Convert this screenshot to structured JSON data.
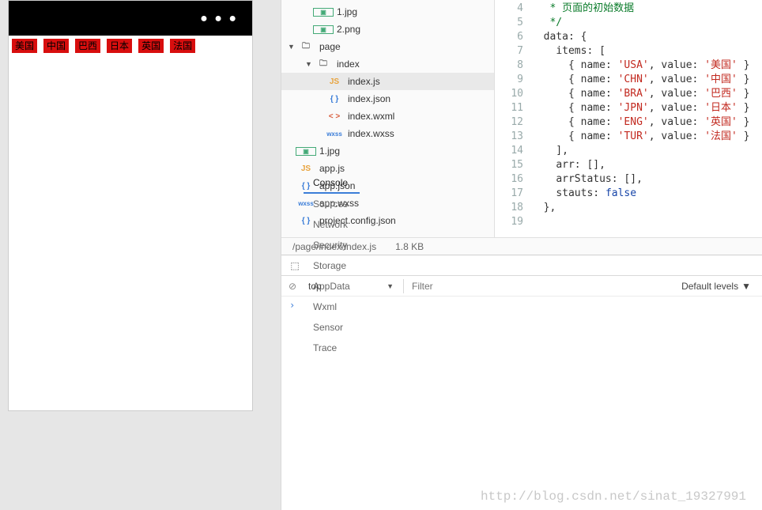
{
  "simulator": {
    "dots": "● ● ●",
    "tags": [
      "美国",
      "中国",
      "巴西",
      "日本",
      "英国",
      "法国"
    ]
  },
  "filetree": [
    {
      "indent": 1,
      "arrow": "",
      "icon": "img",
      "iconText": "▣",
      "label": "1.jpg"
    },
    {
      "indent": 1,
      "arrow": "",
      "icon": "img",
      "iconText": "▣",
      "label": "2.png"
    },
    {
      "indent": 0,
      "arrow": "▼",
      "icon": "folder",
      "iconText": "🗀",
      "label": "page"
    },
    {
      "indent": 1,
      "arrow": "▼",
      "icon": "folder",
      "iconText": "🗀",
      "label": "index"
    },
    {
      "indent": 2,
      "arrow": "",
      "icon": "js",
      "iconText": "JS",
      "label": "index.js",
      "selected": true
    },
    {
      "indent": 2,
      "arrow": "",
      "icon": "json",
      "iconText": "{ }",
      "label": "index.json"
    },
    {
      "indent": 2,
      "arrow": "",
      "icon": "wxml",
      "iconText": "< >",
      "label": "index.wxml"
    },
    {
      "indent": 2,
      "arrow": "",
      "icon": "wxss",
      "iconText": "wxss",
      "label": "index.wxss"
    },
    {
      "indent": 0,
      "arrow": "",
      "icon": "img",
      "iconText": "▣",
      "label": "1.jpg"
    },
    {
      "indent": 0,
      "arrow": "",
      "icon": "js",
      "iconText": "JS",
      "label": "app.js"
    },
    {
      "indent": 0,
      "arrow": "",
      "icon": "json",
      "iconText": "{ }",
      "label": "app.json"
    },
    {
      "indent": 0,
      "arrow": "",
      "icon": "wxss",
      "iconText": "wxss",
      "label": "app.wxss"
    },
    {
      "indent": 0,
      "arrow": "",
      "icon": "json",
      "iconText": "{ }",
      "label": "project.config.json"
    }
  ],
  "code": {
    "startLine": 4,
    "lines": [
      {
        "n": 4,
        "html": "   <span class='cm'>* 页面的初始数据</span>"
      },
      {
        "n": 5,
        "html": "   <span class='cm'>*/</span>"
      },
      {
        "n": 6,
        "html": "  <span class='key'>data</span>: {"
      },
      {
        "n": 7,
        "html": "    <span class='key'>items</span>: ["
      },
      {
        "n": 8,
        "html": "      { <span class='key'>name</span>: <span class='str'>'USA'</span>, <span class='key'>value</span>: <span class='str'>'美国'</span> }"
      },
      {
        "n": 9,
        "html": "      { <span class='key'>name</span>: <span class='str'>'CHN'</span>, <span class='key'>value</span>: <span class='str'>'中国'</span> }"
      },
      {
        "n": 10,
        "html": "      { <span class='key'>name</span>: <span class='str'>'BRA'</span>, <span class='key'>value</span>: <span class='str'>'巴西'</span> }"
      },
      {
        "n": 11,
        "html": "      { <span class='key'>name</span>: <span class='str'>'JPN'</span>, <span class='key'>value</span>: <span class='str'>'日本'</span> }"
      },
      {
        "n": 12,
        "html": "      { <span class='key'>name</span>: <span class='str'>'ENG'</span>, <span class='key'>value</span>: <span class='str'>'英国'</span> }"
      },
      {
        "n": 13,
        "html": "      { <span class='key'>name</span>: <span class='str'>'TUR'</span>, <span class='key'>value</span>: <span class='str'>'法国'</span> }"
      },
      {
        "n": 14,
        "html": "    ],"
      },
      {
        "n": 15,
        "html": "    <span class='key'>arr</span>: [],"
      },
      {
        "n": 16,
        "html": "    <span class='key'>arrStatus</span>: [],"
      },
      {
        "n": 17,
        "html": "    <span class='key'>stauts</span>: <span class='bool'>false</span>"
      },
      {
        "n": 18,
        "html": "  },"
      },
      {
        "n": 19,
        "html": ""
      }
    ]
  },
  "pathbar": {
    "path": "/page/index/index.js",
    "size": "1.8 KB"
  },
  "devtools": {
    "tabs": [
      "Console",
      "Sources",
      "Network",
      "Security",
      "Storage",
      "AppData",
      "Wxml",
      "Sensor",
      "Trace"
    ],
    "activeTab": "Console",
    "scope": "top",
    "filterPlaceholder": "Filter",
    "levels": "Default levels",
    "prompt": "› "
  },
  "watermark": "http://blog.csdn.net/sinat_19327991"
}
